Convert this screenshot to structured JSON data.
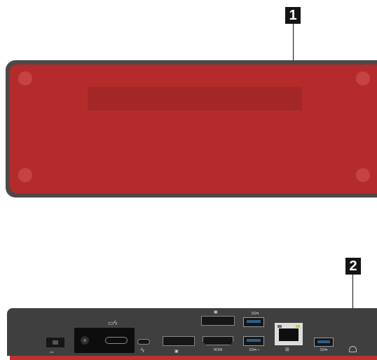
{
  "callouts": [
    {
      "id": "1",
      "label": "1"
    },
    {
      "id": "2",
      "label": "2"
    }
  ],
  "rear_port_labels": {
    "hdmi": "HDMI",
    "usb_top": "SS⇆",
    "usb_bottom": "SS⇆ ⌁",
    "usb_right": "SS⇆"
  },
  "colors": {
    "dock_red": "#b52b2b",
    "dock_gray": "#4a4a4a",
    "callout_bg": "#141414",
    "callout_text": "#ffffff"
  },
  "icons": [
    "power-jack-icon",
    "laptop-lightning-icon",
    "lightning-icon",
    "displayport-icon",
    "network-icon",
    "lock-slot-icon"
  ]
}
